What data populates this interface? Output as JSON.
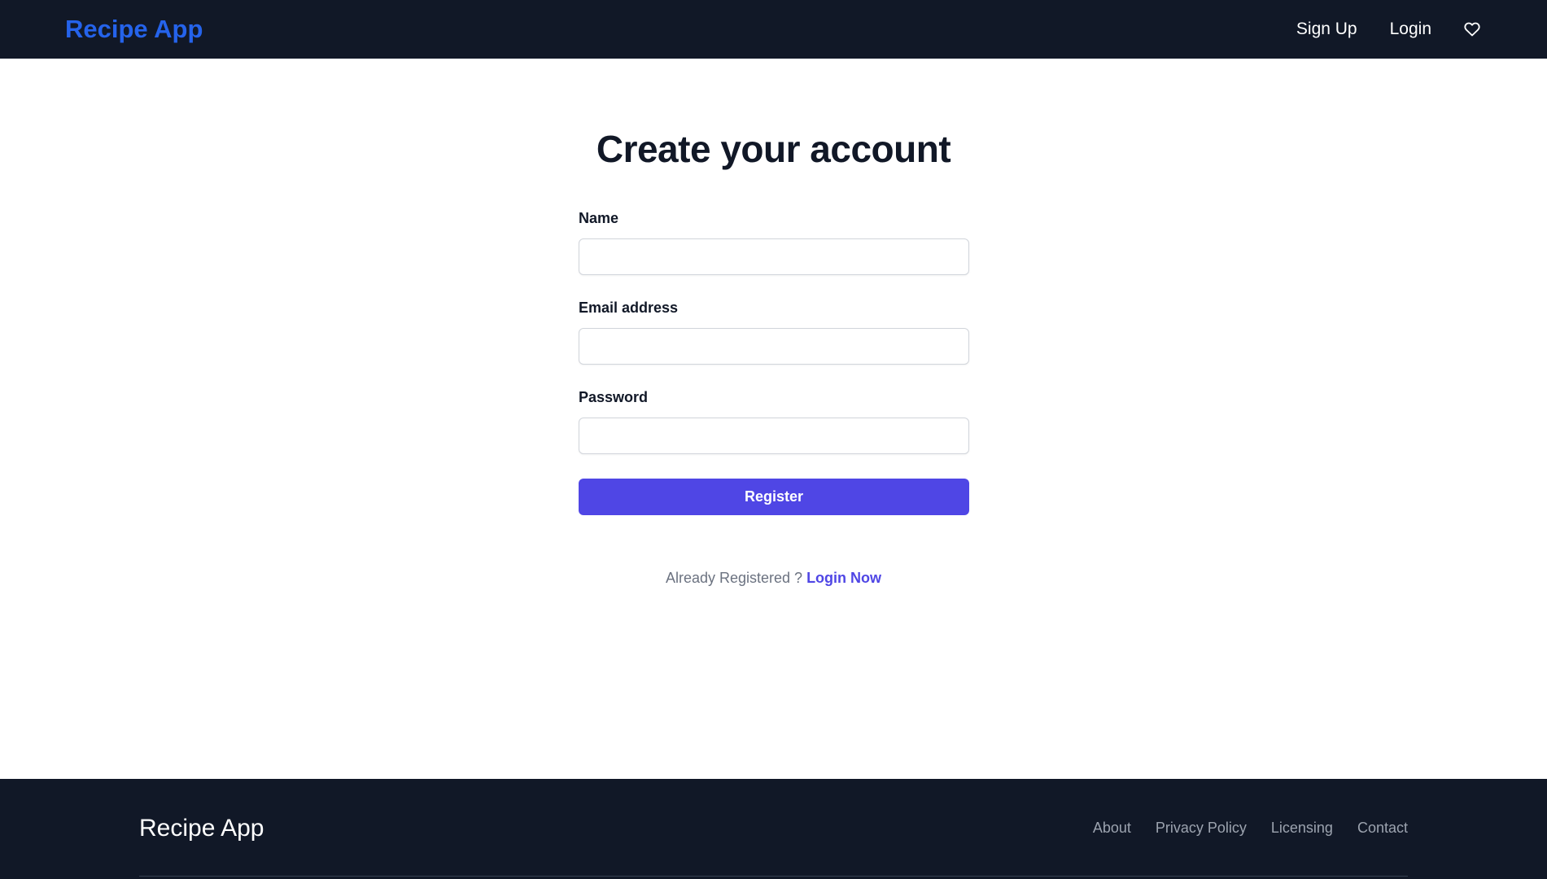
{
  "nav": {
    "brand": "Recipe App",
    "links": [
      "Sign Up",
      "Login"
    ],
    "favorites_icon": "heart-icon"
  },
  "page": {
    "title": "Create your account"
  },
  "form": {
    "name_label": "Name",
    "name_value": "",
    "email_label": "Email address",
    "email_value": "",
    "password_label": "Password",
    "password_value": "",
    "submit_label": "Register"
  },
  "login_prompt": {
    "text": "Already Registered ?",
    "link": "Login Now"
  },
  "footer": {
    "brand": "Recipe App",
    "links": [
      "About",
      "Privacy Policy",
      "Licensing",
      "Contact"
    ]
  },
  "colors": {
    "nav_bg": "#111827",
    "brand": "#2563eb",
    "accent": "#4f46e5"
  }
}
